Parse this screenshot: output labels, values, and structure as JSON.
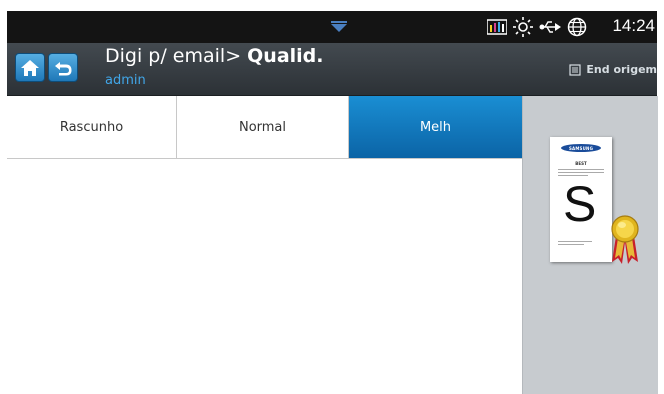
{
  "status_bar": {
    "time": "14:24",
    "icons": [
      "toner-levels-icon",
      "brightness-icon",
      "usb-icon",
      "globe-icon"
    ]
  },
  "header": {
    "breadcrumb": "Digi p/ email> ",
    "title": "Qualid.",
    "user": "admin",
    "end_origem_label": "End origem"
  },
  "tabs": [
    {
      "label": "Rascunho",
      "selected": false
    },
    {
      "label": "Normal",
      "selected": false
    },
    {
      "label": "Melh",
      "selected": true
    }
  ],
  "preview": {
    "brand": "SAMSUNG",
    "heading": "BEST",
    "letter": "S"
  },
  "colors": {
    "selected_tab": "#0b64a6",
    "nav_button": "#2f8fd0",
    "status_bar": "#141414",
    "title_bar": "#373d42",
    "admin_text": "#41a6e8",
    "preview_bg": "#c7cbcf"
  }
}
